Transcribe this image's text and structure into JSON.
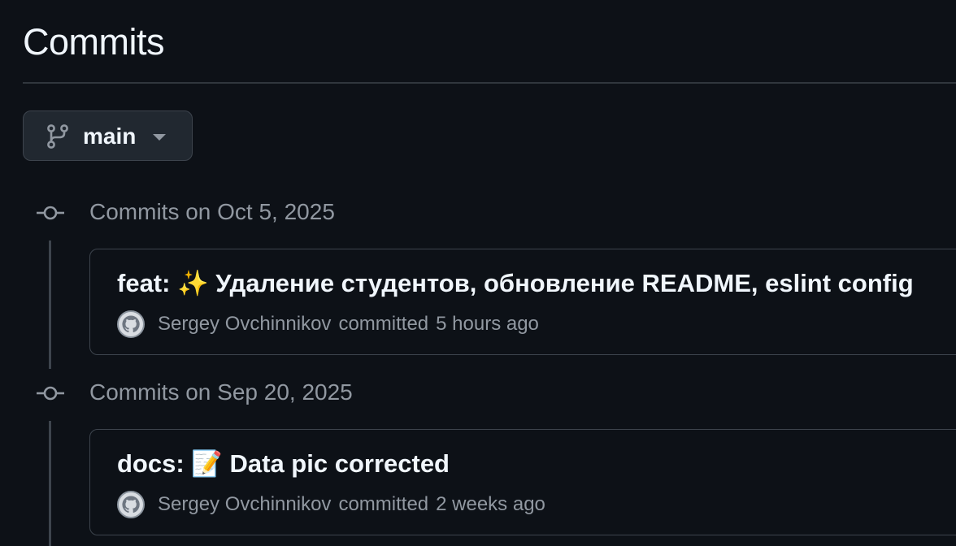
{
  "page": {
    "title": "Commits"
  },
  "branch_selector": {
    "label": "main",
    "icon": "git-branch-icon"
  },
  "commit_groups": [
    {
      "heading": "Commits on Oct 5, 2025",
      "commits": [
        {
          "message": "feat: ✨ Удаление студентов, обновление README, eslint config",
          "author": "Sergey Ovchinnikov",
          "action": "committed",
          "time": "5 hours ago"
        }
      ]
    },
    {
      "heading": "Commits on Sep 20, 2025",
      "commits": [
        {
          "message": "docs: 📝 Data pic corrected",
          "author": "Sergey Ovchinnikov",
          "action": "committed",
          "time": "2 weeks ago"
        }
      ]
    }
  ],
  "colors": {
    "background": "#0d1117",
    "border": "#3d444d",
    "muted_text": "#9198a1",
    "primary_text": "#f0f6fc"
  }
}
